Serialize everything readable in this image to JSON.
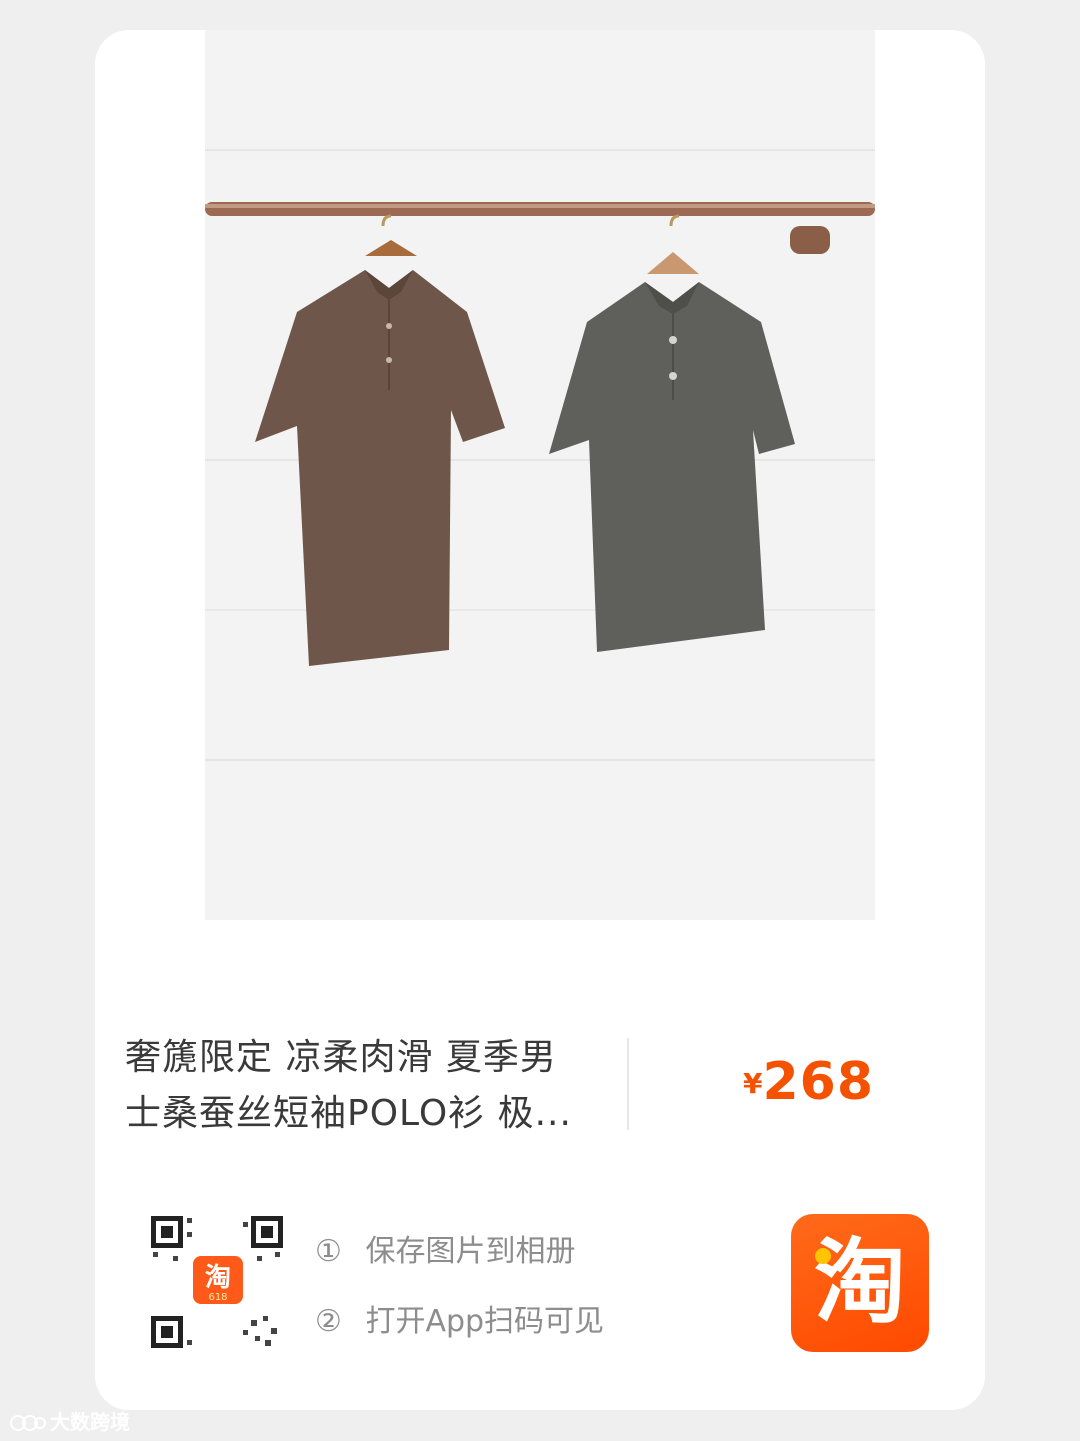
{
  "product": {
    "image_alt": "two short-sleeve polo shirts on hangers",
    "title_line1": "奢篪限定 凉柔肉滑 夏季男",
    "title_line2": "士桑蚕丝短袖POLO衫 极...",
    "price_currency": "¥",
    "price_amount": "268"
  },
  "share": {
    "step1_num": "①",
    "step1_text": "保存图片到相册",
    "step2_num": "②",
    "step2_text": "打开App扫码可见",
    "qr_badge_text": "淘",
    "qr_badge_sub": "618",
    "app_icon_glyph": "淘"
  },
  "watermark": {
    "text": "大数跨境"
  },
  "colors": {
    "accent": "#f45200",
    "taobao_orange": "#ff5000",
    "text_main": "#3a3a3a",
    "text_muted": "#8d8d8d"
  }
}
